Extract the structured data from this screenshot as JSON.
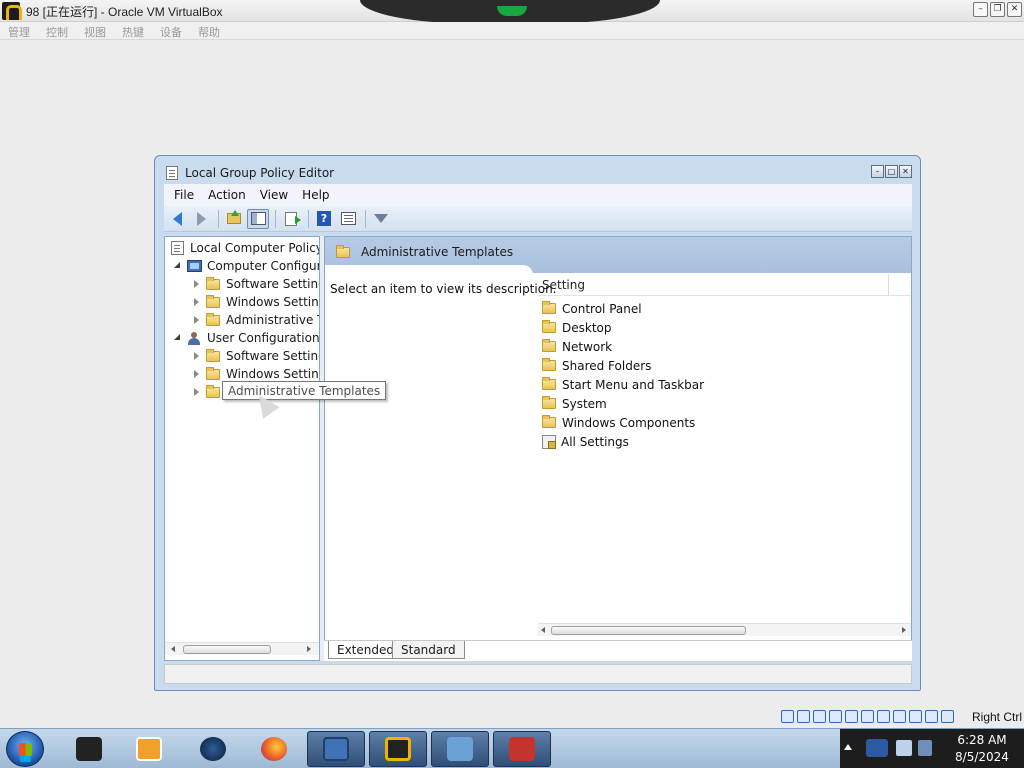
{
  "host": {
    "title": "98 [正在运行] - Oracle VM VirtualBox",
    "menu": [
      "管理",
      "控制",
      "视图",
      "热键",
      "设备",
      "帮助"
    ],
    "right_ctrl": "Right Ctrl"
  },
  "window": {
    "title": "Local Group Policy Editor",
    "menu": [
      "File",
      "Action",
      "View",
      "Help"
    ]
  },
  "tree": {
    "root": "Local Computer Policy",
    "computer_config": "Computer Configura",
    "computer_children": [
      "Software Settings",
      "Windows Setting",
      "Administrative Te"
    ],
    "user_config": "User Configuration",
    "user_children": [
      "Software Settings",
      "Windows Setting",
      "Administrative Templates"
    ]
  },
  "tooltip": "Administrative Templates",
  "content": {
    "header": "Administrative Templates",
    "description": "Select an item to view its description.",
    "column": "Setting",
    "items": [
      "Control Panel",
      "Desktop",
      "Network",
      "Shared Folders",
      "Start Menu and Taskbar",
      "System",
      "Windows Components",
      "All Settings"
    ]
  },
  "tabs": [
    "Extended",
    "Standard"
  ],
  "taskbar": {
    "time": "6:28 AM",
    "date": "8/5/2024"
  }
}
